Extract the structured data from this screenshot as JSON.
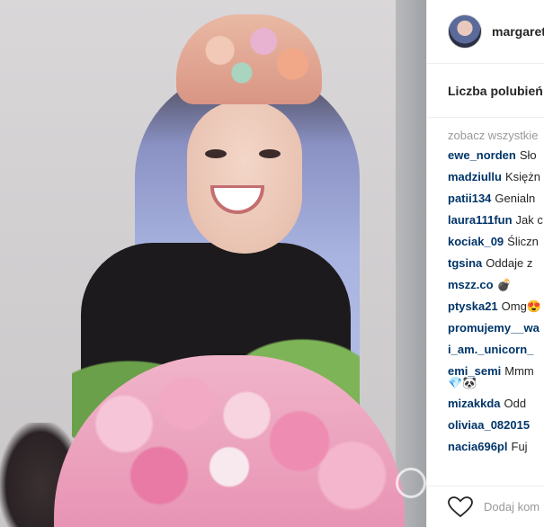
{
  "post": {
    "username": "margaret",
    "likes_label": "Liczba polubień",
    "see_all_label": "zobacz wszystkie",
    "comments": [
      {
        "user": "ewe_norden",
        "text": "Sło"
      },
      {
        "user": "madziullu",
        "text": "Księżn"
      },
      {
        "user": "patii134",
        "text": "Genialn"
      },
      {
        "user": "laura111fun",
        "text": "Jak c"
      },
      {
        "user": "kociak_09",
        "text": "Śliczn"
      },
      {
        "user": "tgsina",
        "text": "Oddaje z"
      },
      {
        "user": "mszz.co",
        "text": "💣"
      },
      {
        "user": "ptyska21",
        "text": "Omg😍"
      },
      {
        "user": "promujemy__wa",
        "text": ""
      },
      {
        "user": "i_am._unicorn_",
        "text": ""
      },
      {
        "user": "emi_semi",
        "text": "Mmm",
        "extra": "💎🐼"
      },
      {
        "user": "mizakkda",
        "text": "Odd"
      },
      {
        "user": "oliviaa_082015",
        "text": ""
      },
      {
        "user": "nacia696pl",
        "text": "Fuj"
      }
    ],
    "add_comment_placeholder": "Dodaj kom"
  },
  "icons": {
    "like": "heart-icon",
    "watermark": "watermark-logo"
  },
  "colors": {
    "username_link": "#003569",
    "text": "#262626",
    "muted": "#999999"
  }
}
